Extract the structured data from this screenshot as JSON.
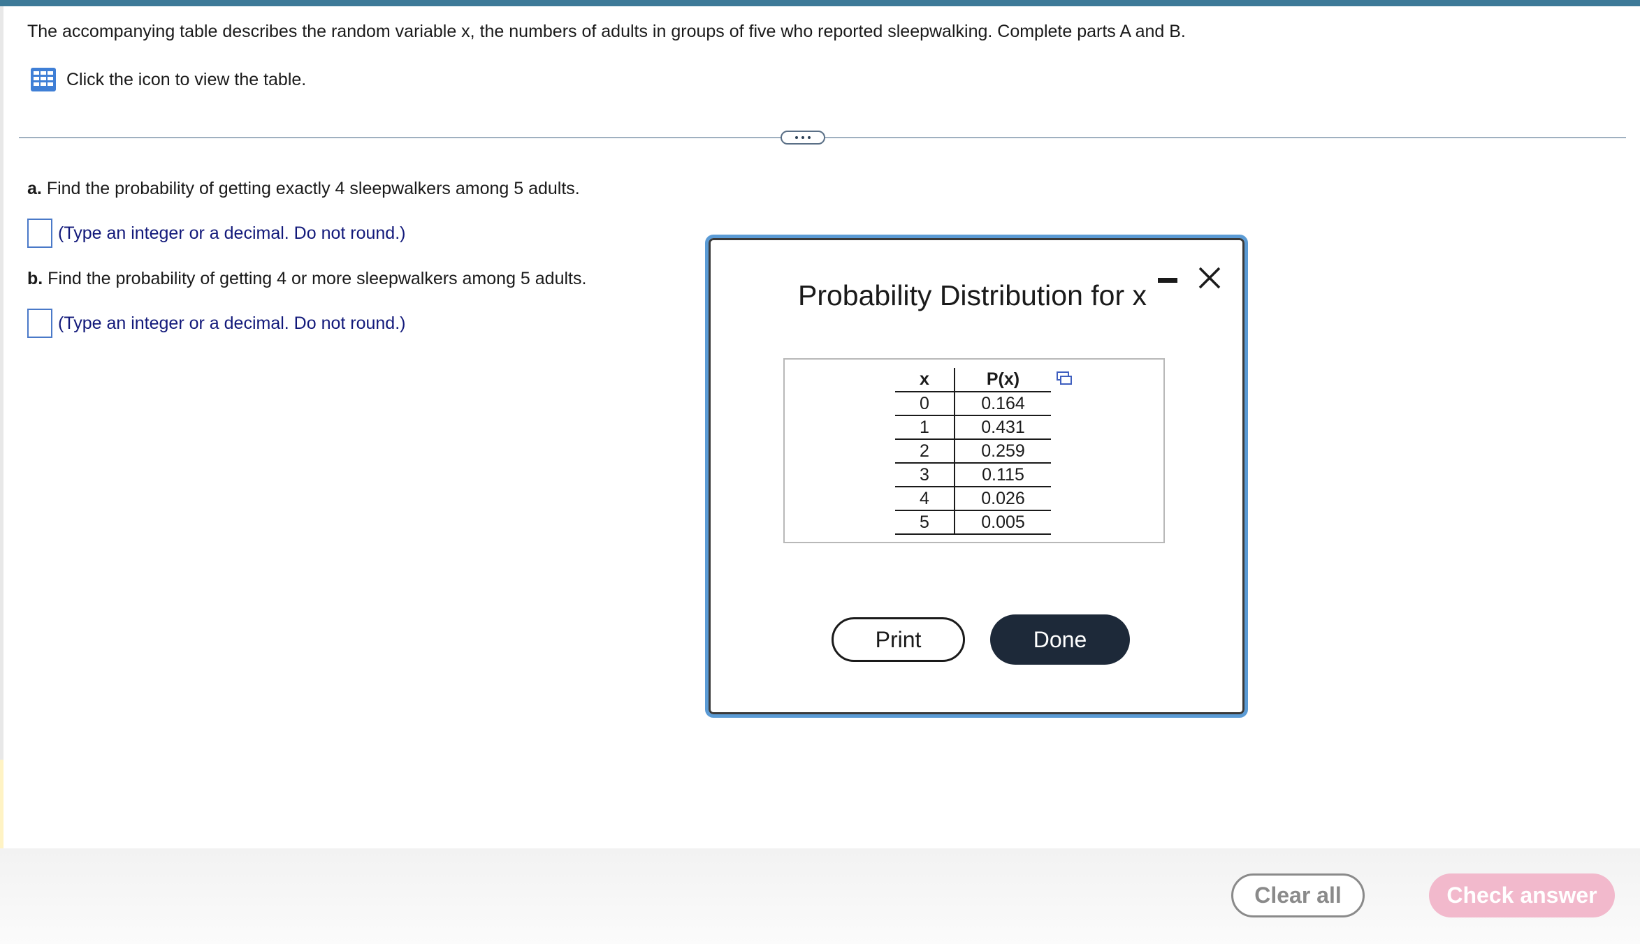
{
  "intro": {
    "text": "The accompanying table describes the random variable x, the numbers of adults in groups of five who reported sleepwalking. Complete parts A and B."
  },
  "table_link": {
    "icon": "table-grid-icon",
    "text": "Click the icon to view the table."
  },
  "questions": {
    "a": {
      "label": "a.",
      "text": "Find the probability of getting exactly 4 sleepwalkers among 5 adults.",
      "answer_value": "",
      "hint": "(Type an integer or a decimal. Do not round.)"
    },
    "b": {
      "label": "b.",
      "text": "Find the probability of getting 4 or more sleepwalkers among 5 adults.",
      "answer_value": "",
      "hint": "(Type an integer or a decimal. Do not round.)"
    }
  },
  "modal": {
    "title": "Probability Distribution for x",
    "table": {
      "headers": [
        "x",
        "P(x)"
      ],
      "rows": [
        [
          "0",
          "0.164"
        ],
        [
          "1",
          "0.431"
        ],
        [
          "2",
          "0.259"
        ],
        [
          "3",
          "0.115"
        ],
        [
          "4",
          "0.026"
        ],
        [
          "5",
          "0.005"
        ]
      ]
    },
    "print_label": "Print",
    "done_label": "Done"
  },
  "footer": {
    "clear_label": "Clear all",
    "check_label": "Check answer"
  },
  "colors": {
    "top_bar": "#3d7a98",
    "modal_border": "#5b9bd5",
    "done_button": "#1d2939",
    "check_button": "#f2b9cc",
    "hint_text": "#12197a"
  }
}
